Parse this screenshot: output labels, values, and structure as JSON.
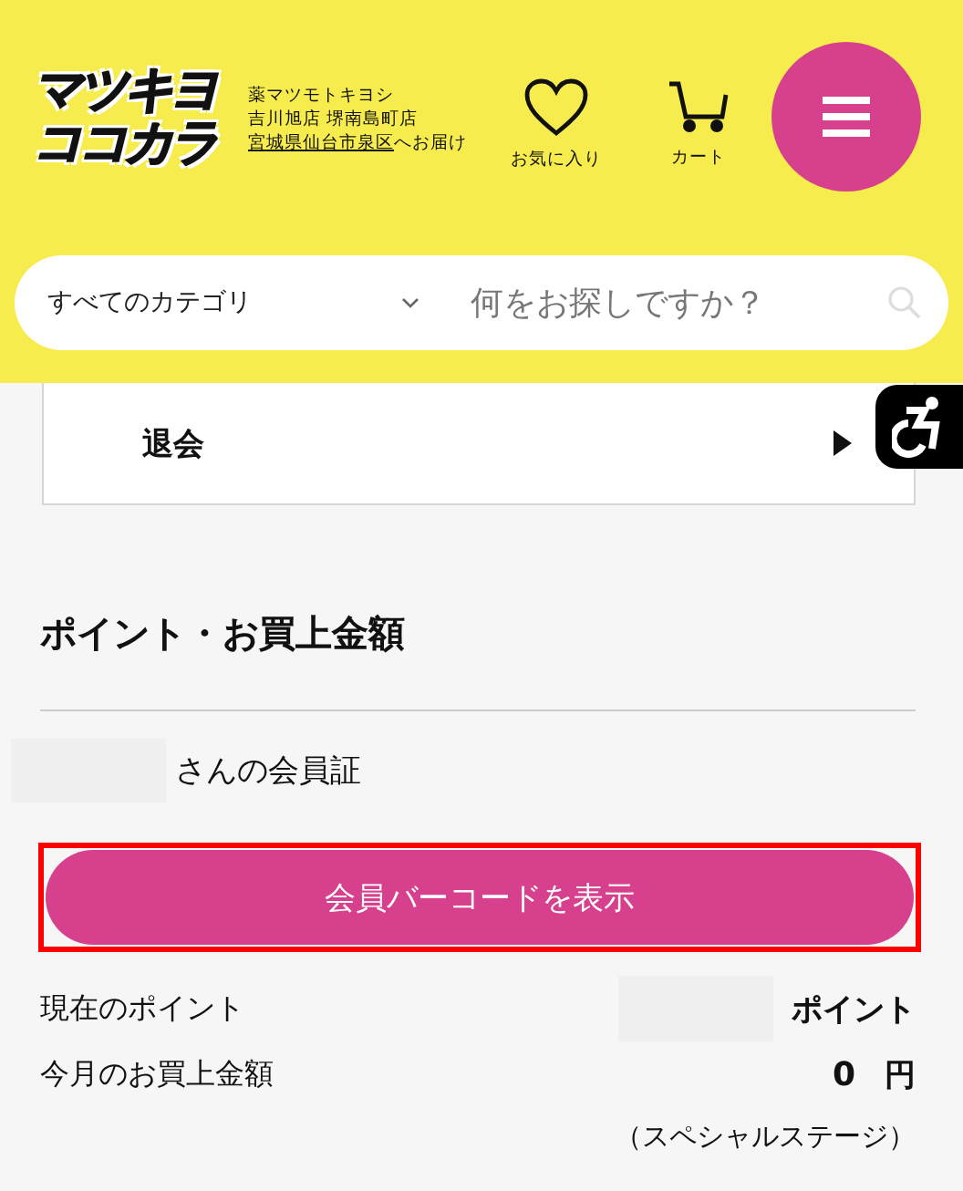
{
  "header": {
    "logo": [
      "マツキヨ",
      "ココカラ"
    ],
    "store": {
      "lines": [
        "薬マツモトキヨシ",
        "吉川旭店 堺南島町店"
      ],
      "delivery_link": "宮城県仙台市泉区",
      "delivery_suffix": "へお届け"
    },
    "favorites": "お気に入り",
    "cart": "カート"
  },
  "search": {
    "category": "すべてのカテゴリ",
    "placeholder": "何をお探しですか？"
  },
  "menu_card": {
    "item": "退会"
  },
  "points": {
    "heading": "ポイント・お買上金額",
    "member_card": "さんの会員証",
    "barcode_button": {
      "label": "会員バーコードを表示",
      "highlighted": true
    },
    "rows": [
      {
        "label": "現在のポイント",
        "value": "",
        "unit": "ポイント"
      },
      {
        "label": "今月のお買上金額",
        "value": "0",
        "unit": "円"
      }
    ],
    "stage": "（スペシャルステージ）"
  }
}
